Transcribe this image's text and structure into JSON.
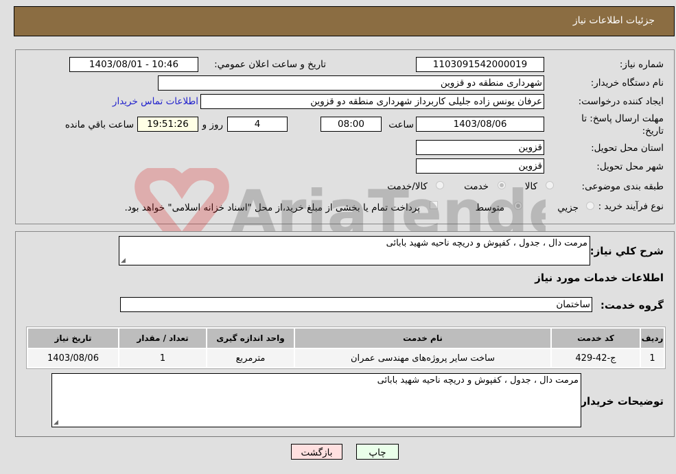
{
  "header": {
    "title": "جزئیات اطلاعات نیاز"
  },
  "details": {
    "need_number_label": "شماره نیاز:",
    "need_number": "1103091542000019",
    "announce_label": "تاريخ و ساعت اعلان عمومي:",
    "announce_value": "1403/08/01 - 10:46",
    "buyer_org_label": "نام دستگاه خریدار:",
    "buyer_org": "شهرداری منطقه دو قزوین",
    "creator_label": "ایجاد کننده درخواست:",
    "creator": "عرفان یونس زاده جلیلی کاربرداز شهرداری منطقه دو قزوین",
    "contact_link": "اطلاعات تماس خریدار",
    "deadline_label": "مهلت ارسال پاسخ: تا تاریخ:",
    "deadline_date": "1403/08/06",
    "time_label": "ساعت",
    "deadline_time": "08:00",
    "days_value": "4",
    "days_label": "روز و",
    "remaining_value": "19:51:26",
    "remaining_label": "ساعت باقي مانده",
    "province_label": "استان محل تحویل:",
    "province": "قزوین",
    "city_label": "شهر محل تحویل:",
    "city": "قزوین",
    "category_label": "طبقه بندی موضوعی:",
    "category_options": [
      {
        "label": "کالا",
        "checked": false
      },
      {
        "label": "خدمت",
        "checked": true
      },
      {
        "label": "کالا/خدمت",
        "checked": false
      }
    ],
    "process_label": "نوع فرآیند خرید :",
    "process_options": [
      {
        "label": "جزيي",
        "checked": false
      },
      {
        "label": "متوسط",
        "checked": true
      }
    ],
    "treasury_checkbox_label": "پرداخت تمام یا بخشی از مبلغ خرید،از محل \"اسناد خزانه اسلامی\" خواهد بود.",
    "treasury_checked": false
  },
  "summary": {
    "description_label": "شرح كلي نياز:",
    "description": "مرمت دال ، جدول ، کفپوش و دریچه ناحیه شهید بابائی",
    "services_heading": "اطلاعات خدمات مورد نياز",
    "service_group_label": "گروه خدمت:",
    "service_group": "ساختمان",
    "table": {
      "headers": [
        "رديف",
        "كد خدمت",
        "نام خدمت",
        "واحد اندازه گيری",
        "تعداد / مقدار",
        "تاريخ نياز"
      ],
      "rows": [
        [
          "1",
          "ج-42-429",
          "ساخت سایر پروژه‌های مهندسی عمران",
          "مترمربع",
          "1",
          "1403/08/06"
        ]
      ]
    },
    "buyer_notes_label": "توضيحات خريدار:",
    "buyer_notes": "مرمت دال ، جدول ، کفپوش و دریچه ناحیه شهید بابائی"
  },
  "buttons": {
    "print": "چاپ",
    "back": "بازگشت"
  },
  "watermark": {
    "text": "AriaTender.neT"
  },
  "colors": {
    "header_bg": "#8b6d42",
    "print_bg": "#eaffea",
    "back_bg": "#ffe0e0",
    "link": "#2222cc"
  }
}
